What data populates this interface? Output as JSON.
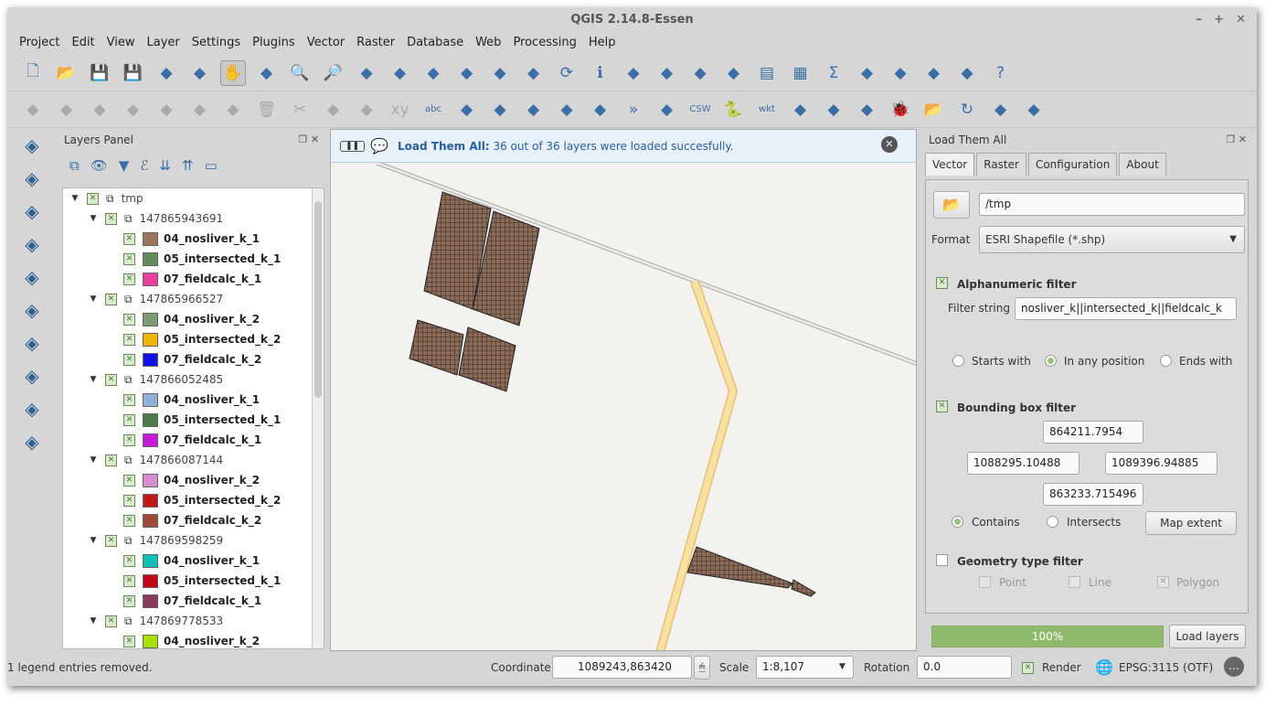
{
  "window": {
    "title": "QGIS 2.14.8-Essen",
    "controls": [
      "–",
      "+",
      "✕"
    ]
  },
  "menu": [
    "Project",
    "Edit",
    "View",
    "Layer",
    "Settings",
    "Plugins",
    "Vector",
    "Raster",
    "Database",
    "Web",
    "Processing",
    "Help"
  ],
  "toolbar1": [
    "new-project",
    "open-project",
    "save-project",
    "save-as",
    "new-print-composer",
    "composer-manager",
    "pan",
    "pan-to-selection",
    "zoom-in",
    "zoom-out",
    "zoom-native",
    "zoom-full",
    "zoom-layer",
    "zoom-selection",
    "zoom-last",
    "zoom-next",
    "refresh",
    "identify",
    "action",
    "select",
    "measure",
    "deselect",
    "attribute-table",
    "statistics",
    "sum",
    "measure-line",
    "annotation",
    "text-annotation",
    "label",
    "help"
  ],
  "toolbar2": [
    "current-edits",
    "toggle-editing",
    "save-edits",
    "add-feature",
    "vertex-tool",
    "move-feature",
    "node-tool",
    "delete-selected",
    "cut",
    "copy",
    "paste",
    "xy",
    "label-abc",
    "label-pin",
    "label-move",
    "label-show",
    "label-rotate",
    "label-change",
    "more",
    "georef",
    "csw",
    "python",
    "wkt",
    "null",
    "plugin-a",
    "plugin-b",
    "bug",
    "open-folder",
    "reload",
    "identify-plus",
    "table-manager"
  ],
  "vtoolbar": [
    "add-vector",
    "add-raster",
    "add-postgis",
    "add-spatialite",
    "add-wfs",
    "add-wms",
    "add-wcs",
    "add-virtual",
    "add-delimited",
    "add-gps"
  ],
  "layers_panel": {
    "title": "Layers Panel",
    "root": "tmp",
    "groups": [
      {
        "name": "147865943691",
        "layers": [
          {
            "name": "04_nosliver_k_1",
            "color": "#9b7462"
          },
          {
            "name": "05_intersected_k_1",
            "color": "#5f8a5a"
          },
          {
            "name": "07_fieldcalc_k_1",
            "color": "#e8409a"
          }
        ]
      },
      {
        "name": "147865966527",
        "layers": [
          {
            "name": "04_nosliver_k_2",
            "color": "#7f9a72"
          },
          {
            "name": "05_intersected_k_2",
            "color": "#f0b400"
          },
          {
            "name": "07_fieldcalc_k_2",
            "color": "#1010e8"
          }
        ]
      },
      {
        "name": "147866052485",
        "layers": [
          {
            "name": "04_nosliver_k_1",
            "color": "#8fb0d6"
          },
          {
            "name": "05_intersected_k_1",
            "color": "#4f7a4a"
          },
          {
            "name": "07_fieldcalc_k_1",
            "color": "#c818d8"
          }
        ]
      },
      {
        "name": "147866087144",
        "layers": [
          {
            "name": "04_nosliver_k_2",
            "color": "#d48ccc"
          },
          {
            "name": "05_intersected_k_2",
            "color": "#c01818"
          },
          {
            "name": "07_fieldcalc_k_2",
            "color": "#a04a3a"
          }
        ]
      },
      {
        "name": "147869598259",
        "layers": [
          {
            "name": "04_nosliver_k_1",
            "color": "#10c0b0"
          },
          {
            "name": "05_intersected_k_1",
            "color": "#c00818"
          },
          {
            "name": "07_fieldcalc_k_1",
            "color": "#8a3a5a"
          }
        ]
      },
      {
        "name": "147869778533",
        "layers": [
          {
            "name": "04_nosliver_k_2",
            "color": "#a8e000"
          }
        ]
      }
    ]
  },
  "message": {
    "title": "Load Them All:",
    "text": "36 out of 36 layers were loaded succesfully."
  },
  "plugin": {
    "title": "Load Them All",
    "tabs": [
      "Vector",
      "Raster",
      "Configuration",
      "About"
    ],
    "active_tab": "Vector",
    "path": "/tmp",
    "format_label": "Format",
    "format": "ESRI Shapefile (*.shp)",
    "alpha_filter": {
      "label": "Alphanumeric filter",
      "checked": true,
      "string_label": "Filter string",
      "string": "nosliver_k||intersected_k||fieldcalc_k",
      "options": [
        "Starts with",
        "In any position",
        "Ends with"
      ],
      "selected": "In any position"
    },
    "bbox_filter": {
      "label": "Bounding box filter",
      "checked": true,
      "north": "864211.7954",
      "west": "1088295.10488",
      "east": "1089396.94885",
      "south": "863233.715496",
      "options": [
        "Contains",
        "Intersects"
      ],
      "selected": "Contains",
      "map_extent": "Map extent"
    },
    "geom_filter": {
      "label": "Geometry type filter",
      "checked": false,
      "options": [
        "Point",
        "Line",
        "Polygon"
      ]
    },
    "progress": {
      "value": 100,
      "label": "100%"
    },
    "load_button": "Load layers"
  },
  "status": {
    "message": "1 legend entries removed.",
    "coordinate_label": "Coordinate",
    "coordinate": "1089243,863420",
    "scale_label": "Scale",
    "scale": "1:8,107",
    "rotation_label": "Rotation",
    "rotation": "0.0",
    "render_label": "Render",
    "crs": "EPSG:3115 (OTF)"
  }
}
